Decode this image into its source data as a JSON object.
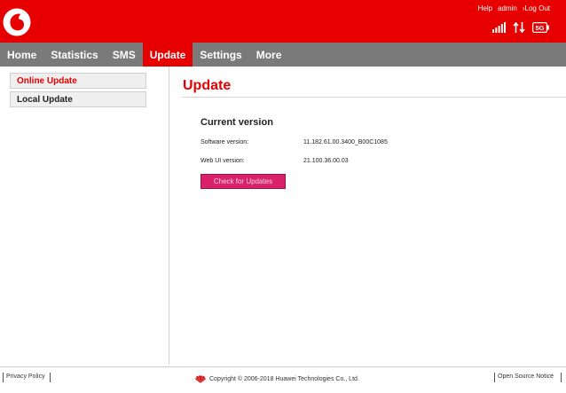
{
  "header": {
    "brand_color": "#e60000",
    "logo_icon": "vodafone-logo",
    "help_label": "Help",
    "user_label": "admin",
    "logout_label": "Log Out",
    "status_icons": [
      "signal-bars-icon",
      "data-transfer-icon",
      "network-4g-icon"
    ],
    "network_badge": "5G"
  },
  "nav": {
    "items": [
      "Home",
      "Statistics",
      "SMS",
      "Update",
      "Settings",
      "More"
    ],
    "active": "Update"
  },
  "sidebar": {
    "items": [
      {
        "label": "Online Update",
        "active": true
      },
      {
        "label": "Local Update",
        "active": false
      }
    ]
  },
  "main": {
    "title": "Update",
    "section_title": "Current version",
    "software_version_label": "Software version:",
    "software_version_value": "11.182.61.00.3400_B00C1085",
    "webui_version_label": "Web UI version:",
    "webui_version_value": "21.100.36.00.03",
    "check_button_label": "Check for Updates",
    "button_color": "#d9206b"
  },
  "footer": {
    "privacy_label": "Privacy Policy",
    "copyright": "Copyright © 2006-2018 Huawei Technologies Co., Ltd.",
    "open_source_label": "Open Source Notice",
    "huawei_icon": "huawei-logo"
  }
}
